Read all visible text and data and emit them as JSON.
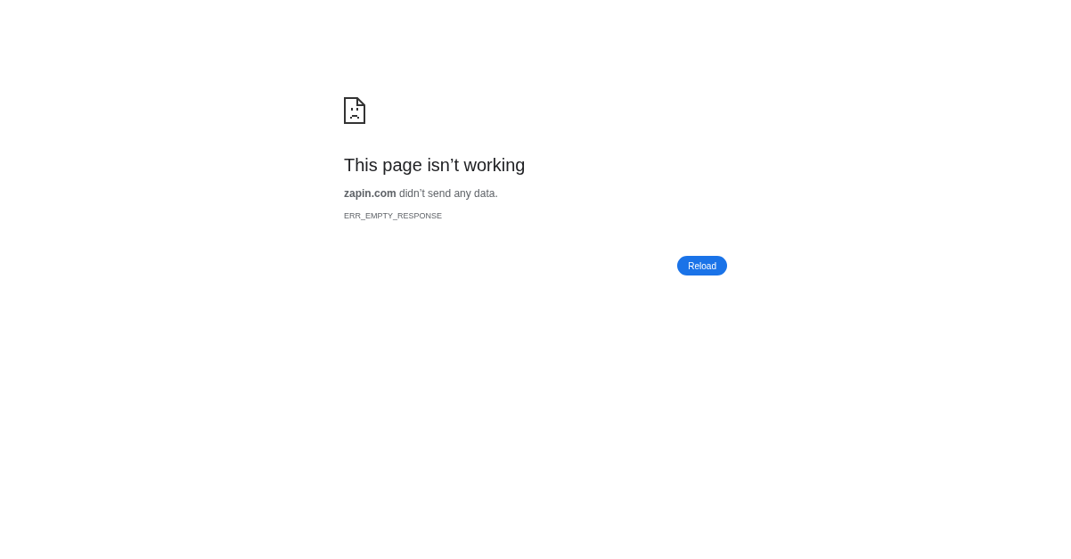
{
  "heading": "This page isn’t working",
  "message": "**zapin.com** didn’t send any data.",
  "error_code": "ERR_EMPTY_RESPONSE",
  "buttons": [
    {
      "label": "Reload"
    }
  ]
}
